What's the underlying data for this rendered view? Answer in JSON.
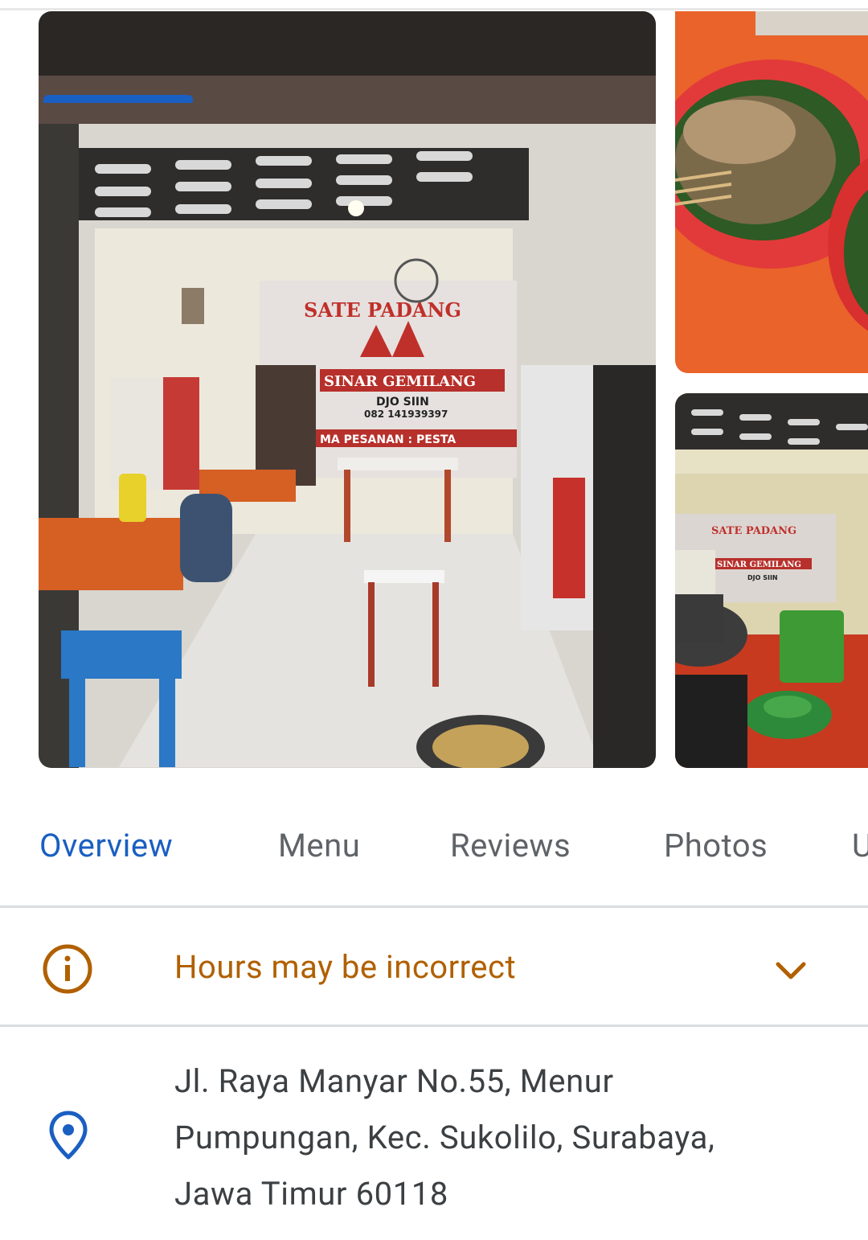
{
  "photos": {
    "main": {
      "alt_icon": "restaurant-interior-photo",
      "sign_line1": "SATE PADANG",
      "sign_line2": "SINAR GEMILANG",
      "sign_line3": "DJO SIIN",
      "sign_line4": "082 141939397",
      "sign_line5": "MA PESANAN : PESTA"
    },
    "top_right": {
      "alt_icon": "sate-dish-photo"
    },
    "bottom_right": {
      "alt_icon": "restaurant-counter-photo",
      "sign_line1": "SATE PADANG",
      "sign_line2": "SINAR GEMILANG",
      "sign_line3": "DJO SIIN"
    }
  },
  "tabs": [
    {
      "label": "Overview",
      "active": true
    },
    {
      "label": "Menu",
      "active": false
    },
    {
      "label": "Reviews",
      "active": false
    },
    {
      "label": "Photos",
      "active": false
    },
    {
      "label": "U",
      "active": false
    }
  ],
  "hours": {
    "icon": "info-icon",
    "text": "Hours may be incorrect",
    "expand_icon": "chevron-down-icon",
    "color": "#b06000"
  },
  "address": {
    "icon": "location-pin-icon",
    "lines": [
      "Jl. Raya Manyar No.55, Menur",
      "Pumpungan, Kec. Sukolilo, Surabaya,",
      "Jawa Timur 60118"
    ]
  },
  "colors": {
    "accent": "#1a5fc2",
    "warning": "#b06000",
    "text": "#3c4043",
    "muted": "#5f6368"
  }
}
